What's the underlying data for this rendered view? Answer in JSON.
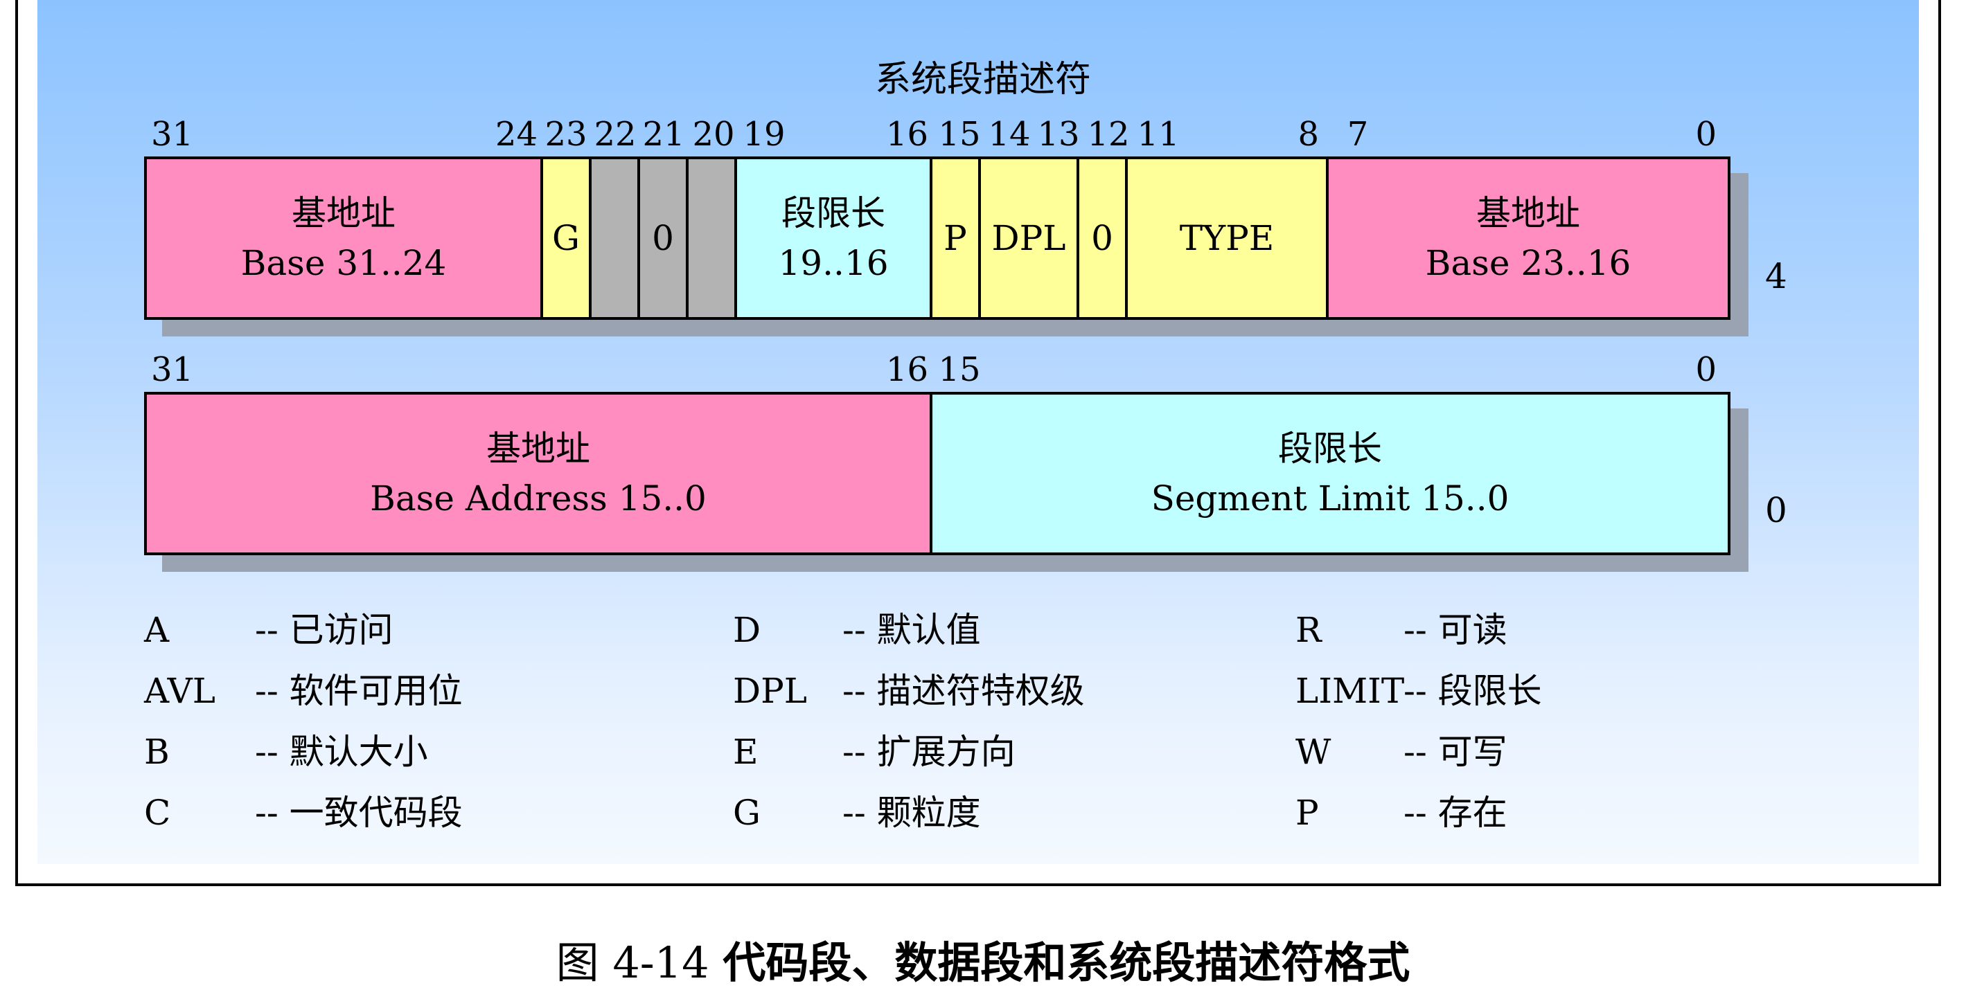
{
  "title": "系统段描述符",
  "row1": {
    "bit_numbers": [
      "31",
      "24",
      "23",
      "22",
      "21",
      "20",
      "19",
      "16",
      "15",
      "14",
      "13",
      "12",
      "11",
      "8",
      "7",
      "0"
    ],
    "fields": [
      {
        "line1": "基地址",
        "line2": "Base 31..24"
      },
      {
        "line1": "G"
      },
      {
        "line1": ""
      },
      {
        "line1": "0"
      },
      {
        "line1": ""
      },
      {
        "line1": "段限长",
        "line2": "19..16"
      },
      {
        "line1": "P"
      },
      {
        "line1": "DPL"
      },
      {
        "line1": "0"
      },
      {
        "line1": "TYPE"
      },
      {
        "line1": "基地址",
        "line2": "Base 23..16"
      }
    ],
    "offset": "4"
  },
  "row2": {
    "bit_numbers": [
      "31",
      "16",
      "15",
      "0"
    ],
    "fields": [
      {
        "line1": "基地址",
        "line2": "Base Address 15..0"
      },
      {
        "line1": "段限长",
        "line2": "Segment Limit 15..0"
      }
    ],
    "offset": "0"
  },
  "legend": [
    [
      {
        "key": "A",
        "desc": "-- 已访问"
      },
      {
        "key": "D",
        "desc": "-- 默认值"
      },
      {
        "key": "R",
        "desc": "-- 可读"
      }
    ],
    [
      {
        "key": "AVL",
        "desc": "-- 软件可用位"
      },
      {
        "key": "DPL",
        "desc": "-- 描述符特权级"
      },
      {
        "key": "LIMIT",
        "desc": "-- 段限长"
      }
    ],
    [
      {
        "key": "B",
        "desc": "-- 默认大小"
      },
      {
        "key": "E",
        "desc": "-- 扩展方向"
      },
      {
        "key": "W",
        "desc": "-- 可写"
      }
    ],
    [
      {
        "key": "C",
        "desc": "-- 一致代码段"
      },
      {
        "key": "G",
        "desc": "-- 颗粒度"
      },
      {
        "key": "P",
        "desc": "-- 存在"
      }
    ]
  ],
  "caption": {
    "number": "图 4-14",
    "text": "代码段、数据段和系统段描述符格式"
  },
  "colors": {
    "base": "#ff8dc0",
    "flag": "#ffff99",
    "reserved": "#b3b3b3",
    "limit": "#bfffff",
    "shadow": "#9aa3b2"
  }
}
